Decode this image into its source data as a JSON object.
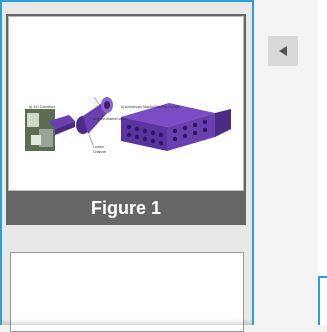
{
  "thumbnails": [
    {
      "caption": "Figure 1",
      "panel_a_label": "a) 3-D Construct",
      "panel_b_label": "b) Anisotropic Macro-Channel Cryogel",
      "annotation_1": "Aligned channel walls",
      "annotation_2": "Lumen",
      "annotation_3": "Channel"
    },
    {
      "caption": ""
    }
  ],
  "controls": {
    "collapse_icon": "triangle-left-icon"
  },
  "colors": {
    "accent": "#2aa0d8",
    "caption_bg": "#666666",
    "purple": "#6a3fb0"
  }
}
